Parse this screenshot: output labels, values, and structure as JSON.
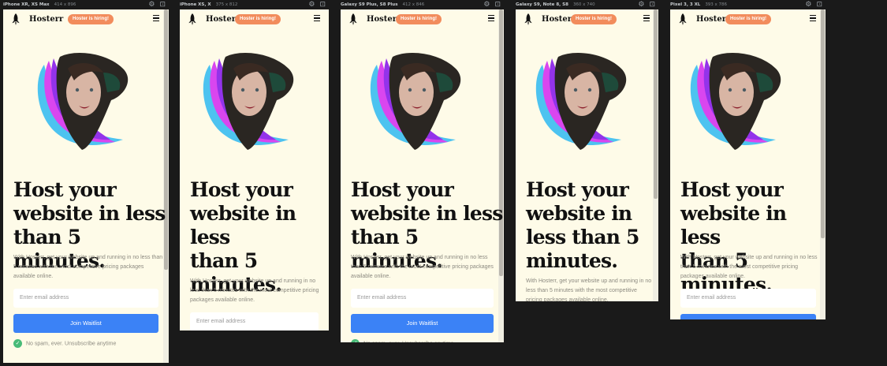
{
  "colors": {
    "page_bg": "#fefbe8",
    "accent": "#3b82f6",
    "badge": "#f28c5c",
    "success": "#48bb78"
  },
  "app": {
    "brand": "Hosterr",
    "badge": "Hoster is hiring!",
    "headline_line1": "Host your",
    "description": "With Hosterr, get your website up and running in no less than 5 minutes with the most competitive pricing packages available online.",
    "email_placeholder": "Enter email address",
    "join_label": "Join Waitlist",
    "no_spam": "No spam, ever. Unsubscribe anytime",
    "menu_icon": "hamburger-icon",
    "logo_icon": "rocket-icon",
    "hero_alt": "woman-portrait-with-colorful-shapes"
  },
  "devices": [
    {
      "name": "iPhone XR, XS Max",
      "size": "414 x 896",
      "headline_lines": [
        "Host your",
        "website in less",
        "than 5 minutes."
      ]
    },
    {
      "name": "iPhone XS, X",
      "size": "375 x 812",
      "headline_lines": [
        "Host your",
        "website in less",
        "than 5",
        "minutes."
      ]
    },
    {
      "name": "Galaxy S9 Plus, S8 Plus",
      "size": "412 x 846",
      "headline_lines": [
        "Host your",
        "website in less",
        "than 5 minutes."
      ]
    },
    {
      "name": "Galaxy S9, Note 8, S8",
      "size": "360 x 740",
      "headline_lines": [
        "Host your",
        "website in",
        "less than 5",
        "minutes."
      ]
    },
    {
      "name": "Pixel 3, 3 XL",
      "size": "393 x 786",
      "headline_lines": [
        "Host your",
        "website in less",
        "than 5 minutes."
      ]
    }
  ],
  "toolbar_icons": [
    "settings-icon",
    "screenshot-icon"
  ]
}
